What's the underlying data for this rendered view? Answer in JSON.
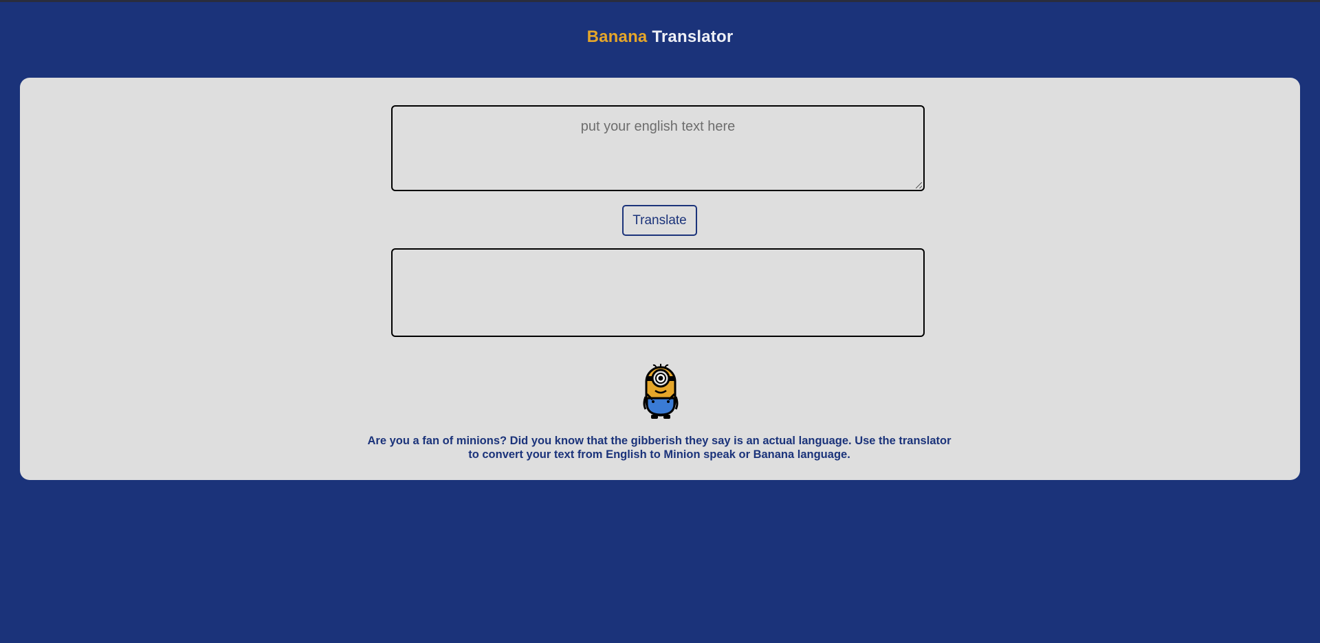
{
  "header": {
    "brand_accent": "Banana",
    "brand_main": "Translator"
  },
  "input": {
    "placeholder": "put your english text here",
    "value": ""
  },
  "button": {
    "translate_label": "Translate"
  },
  "output": {
    "text": ""
  },
  "illustration": {
    "icon": "minion-icon"
  },
  "description": {
    "text": "Are you a fan of minions? Did you know that the gibberish they say is an actual language. Use the translator to convert your text from English to Minion speak or Banana language."
  },
  "colors": {
    "background": "#1b337a",
    "card": "#dedede",
    "accent": "#e5a62a",
    "header_text": "#eef0f6"
  }
}
